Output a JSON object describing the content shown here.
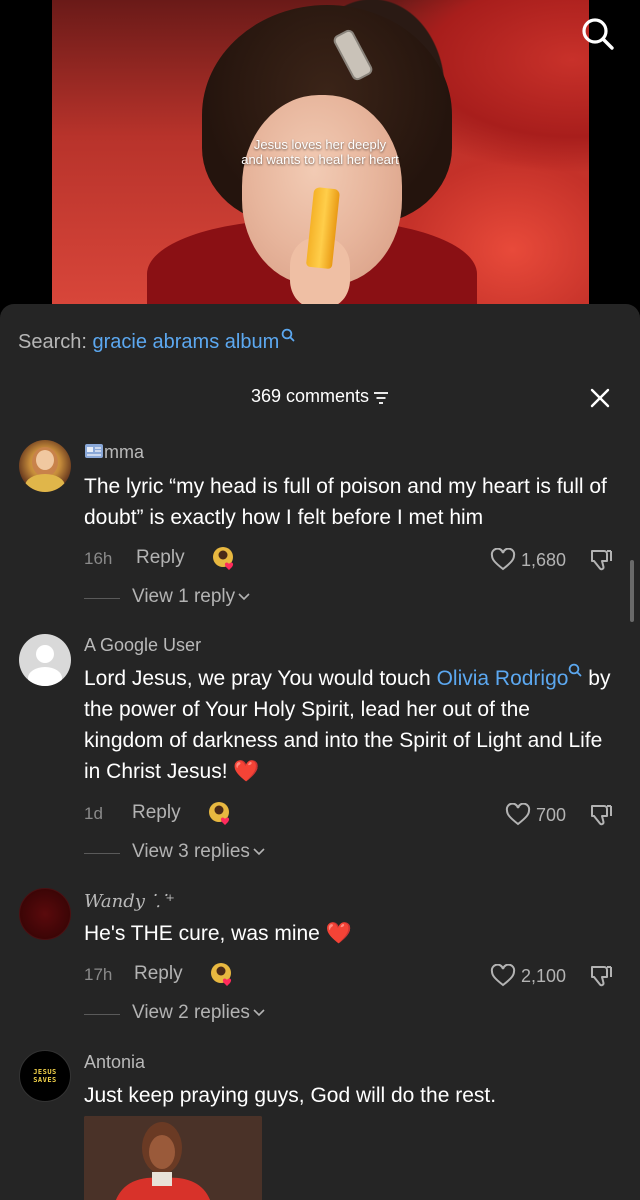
{
  "video": {
    "caption_line1": "Jesus loves her deeply",
    "caption_line2": "and wants to heal her heart"
  },
  "search": {
    "label": "Search:",
    "query": "gracie abrams album"
  },
  "comments_header": {
    "count_label": "369 comments"
  },
  "comments": [
    {
      "username": "mma",
      "text": "The lyric “my head is full of poison and my heart is full of doubt” is exactly how I felt before I met him",
      "age": "16h",
      "reply_label": "Reply",
      "likes": "1,680",
      "replies_label": "View 1 reply"
    },
    {
      "username": "A Google User",
      "text_pre": "Lord Jesus, we pray You would touch ",
      "text_link": "Olivia Rodrigo",
      "text_post": " by the power of Your Holy Spirit, lead her out of the kingdom of darkness and into the Spirit of Light and Life in Christ Jesus! ❤️",
      "age": "1d",
      "reply_label": "Reply",
      "likes": "700",
      "replies_label": "View 3 replies"
    },
    {
      "username": "Wandy ⸪⁺",
      "text": "He's THE cure, was mine ❤️",
      "age": "17h",
      "reply_label": "Reply",
      "likes": "2,100",
      "replies_label": "View 2 replies"
    },
    {
      "username": "Antonia",
      "text": "Just keep praying guys, God will do the rest.",
      "avatar_text": "JESUS SAVES"
    }
  ],
  "colors": {
    "panel_bg": "#252525",
    "link": "#5ca8f0",
    "heart": "#e0243a"
  }
}
